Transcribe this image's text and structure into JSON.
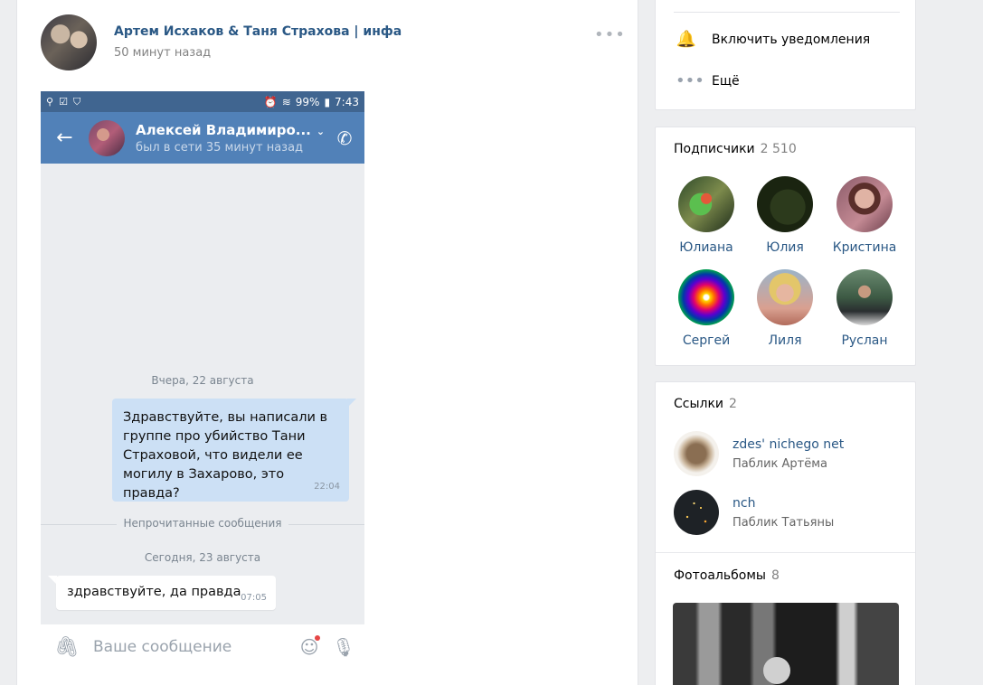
{
  "post": {
    "author": "Артем Исхаков & Таня Страхова | инфа",
    "time": "50 минут назад",
    "more_icon": "more-horizontal-icon"
  },
  "phone": {
    "status_battery": "99%",
    "status_time": "7:43",
    "chat_name": "Алексей Владимиро...",
    "chat_status": "был в сети 35 минут назад",
    "day_yesterday": "Вчера, 22 августа",
    "outgoing_text": "Здравствуйте, вы написали в группе про убийство Тани Страховой, что видели ее могилу в Захарово, это правда?",
    "outgoing_time": "22:04",
    "unread_label": "Непрочитанные сообщения",
    "day_today": "Сегодня, 23 августа",
    "incoming_text": "здравствуйте, да правда",
    "incoming_time": "07:05",
    "composer_placeholder": "Ваше сообщение"
  },
  "actions": {
    "notify": "Включить уведомления",
    "more": "Ещё"
  },
  "subscribers": {
    "title": "Подписчики",
    "count": "2 510",
    "people": [
      {
        "name": "Юлиана"
      },
      {
        "name": "Юлия"
      },
      {
        "name": "Кристина"
      },
      {
        "name": "Сергей"
      },
      {
        "name": "Лиля"
      },
      {
        "name": "Руслан"
      }
    ]
  },
  "links": {
    "title": "Ссылки",
    "count": "2",
    "items": [
      {
        "name": "zdes' nichego net",
        "desc": "Паблик Артёма"
      },
      {
        "name": "nch",
        "desc": "Паблик Татьяны"
      }
    ]
  },
  "albums": {
    "title": "Фотоальбомы",
    "count": "8"
  },
  "colors": {
    "link": "#2a5885",
    "header_blue": "#5181b8",
    "bubble_out": "#cce0f5",
    "page_bg": "#edeef0"
  }
}
